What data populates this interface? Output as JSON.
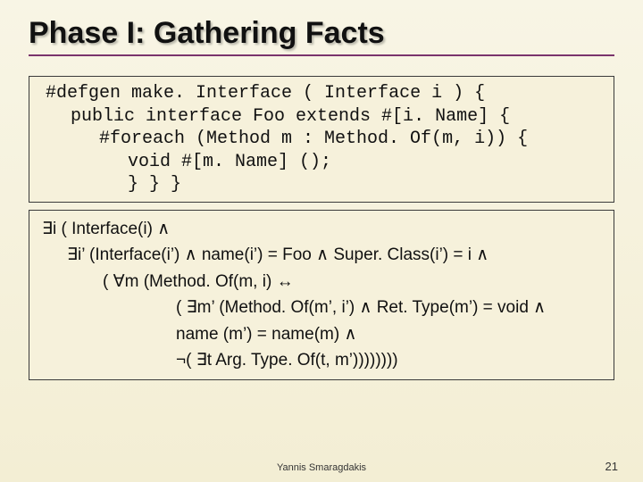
{
  "title": "Phase I: Gathering Facts",
  "code": {
    "l1": "#defgen make. Interface ( Interface i ) {",
    "l2": "public interface Foo extends #[i. Name] {",
    "l3": "#foreach (Method m : Method. Of(m, i)) {",
    "l4": "void #[m. Name] ();",
    "l5": "} } }"
  },
  "logic": {
    "l1": "∃i ( Interface(i) ∧",
    "l2": "∃i’ (Interface(i’) ∧ name(i’) = Foo ∧ Super. Class(i’) = i ∧",
    "l3": "( ∀m (Method. Of(m, i) ↔",
    "l4": "( ∃m’ (Method. Of(m’, i’) ∧ Ret. Type(m’) = void ∧",
    "l5": "name (m’) = name(m) ∧",
    "l6": "¬( ∃t Arg. Type. Of(t, m’))))))))"
  },
  "footer": "Yannis Smaragdakis",
  "page": "21"
}
